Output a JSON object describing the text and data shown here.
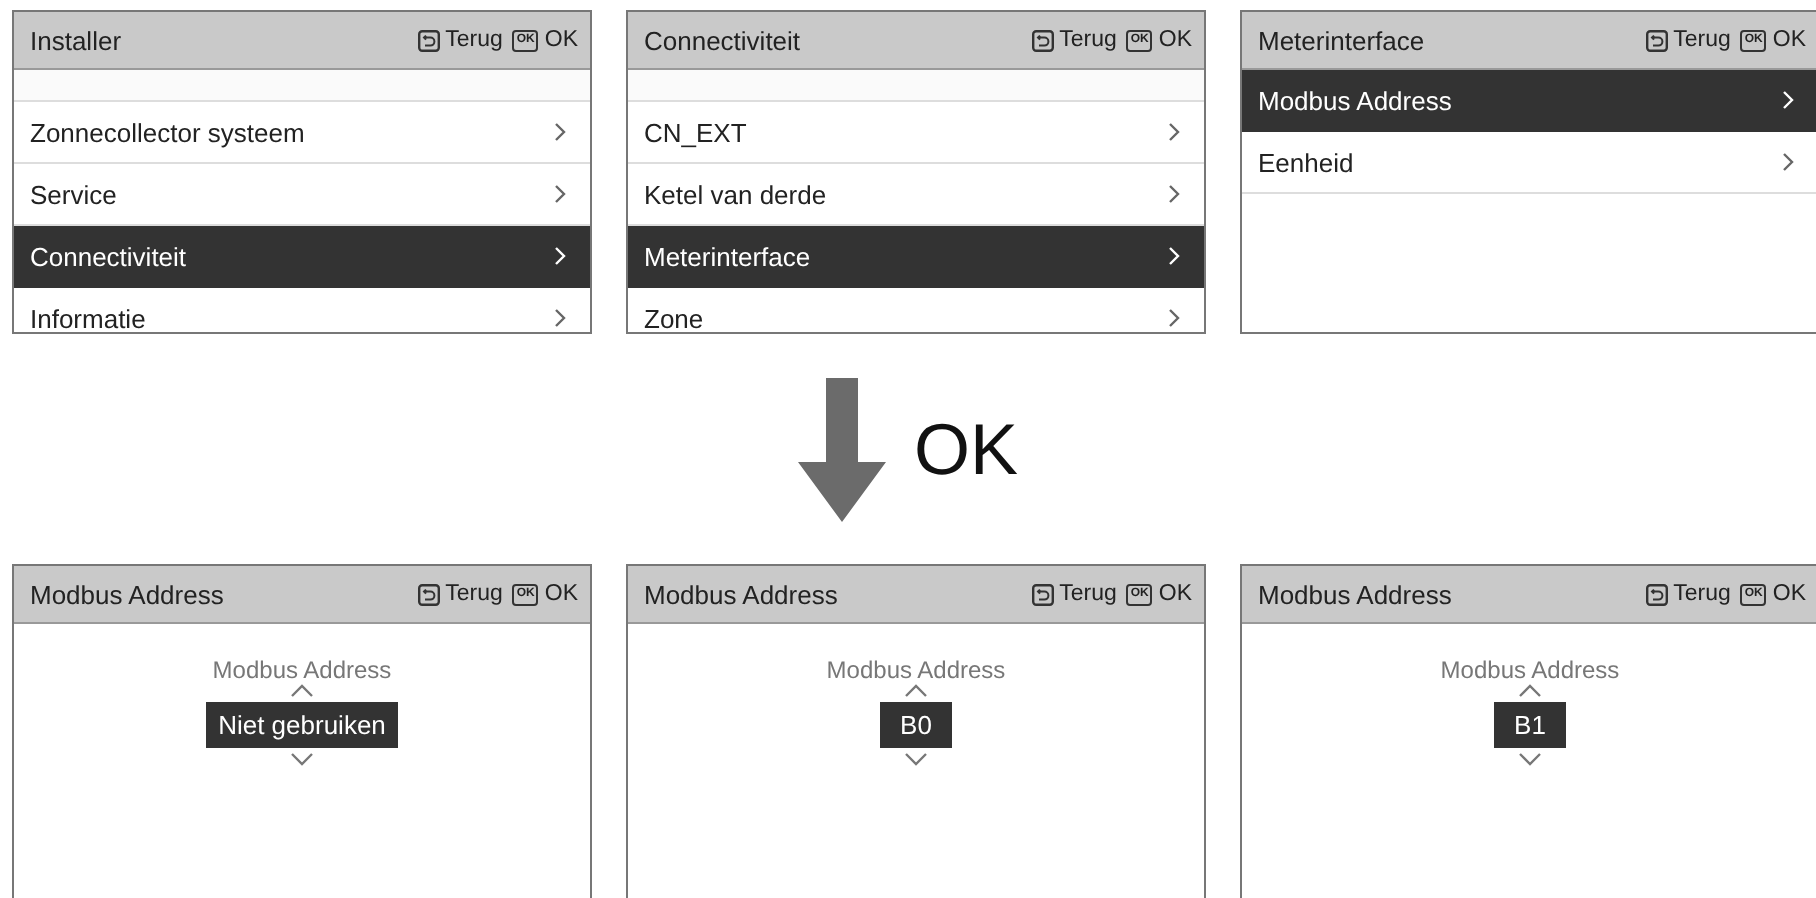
{
  "menu_screens": [
    {
      "title": "Installer",
      "scrolled": true,
      "buttons": [
        {
          "kind": "back",
          "label": "Terug"
        },
        {
          "kind": "ok",
          "key": "OK",
          "label": "OK"
        }
      ],
      "items": [
        {
          "label": "Zonnecollector systeem",
          "selected": false
        },
        {
          "label": "Service",
          "selected": false
        },
        {
          "label": "Connectiviteit",
          "selected": true
        },
        {
          "label": "Informatie",
          "selected": false
        }
      ]
    },
    {
      "title": "Connectiviteit",
      "scrolled": true,
      "buttons": [
        {
          "kind": "back",
          "label": "Terug"
        },
        {
          "kind": "ok",
          "key": "OK",
          "label": "OK"
        }
      ],
      "items": [
        {
          "label": "CN_EXT",
          "selected": false
        },
        {
          "label": "Ketel van derde",
          "selected": false
        },
        {
          "label": "Meterinterface",
          "selected": true
        },
        {
          "label": "Zone",
          "selected": false
        }
      ]
    },
    {
      "title": "Meterinterface",
      "scrolled": false,
      "buttons": [
        {
          "kind": "back",
          "label": "Terug"
        },
        {
          "kind": "ok",
          "key": "OK",
          "label": "OK"
        }
      ],
      "items": [
        {
          "label": "Modbus Address",
          "selected": true
        },
        {
          "label": "Eenheid",
          "selected": false
        }
      ]
    }
  ],
  "step_label": "OK",
  "value_screens": [
    {
      "title": "Modbus Address",
      "buttons": [
        {
          "kind": "back",
          "label": "Terug"
        },
        {
          "kind": "ok",
          "key": "OK",
          "label": "OK"
        }
      ],
      "field_label": "Modbus Address",
      "value": "Niet gebruiken"
    },
    {
      "title": "Modbus Address",
      "buttons": [
        {
          "kind": "back",
          "label": "Terug"
        },
        {
          "kind": "ok",
          "key": "OK",
          "label": "OK"
        }
      ],
      "field_label": "Modbus Address",
      "value": "B0"
    },
    {
      "title": "Modbus Address",
      "buttons": [
        {
          "kind": "back",
          "label": "Terug"
        },
        {
          "kind": "ok",
          "key": "OK",
          "label": "OK"
        }
      ],
      "field_label": "Modbus Address",
      "value": "B1"
    }
  ]
}
